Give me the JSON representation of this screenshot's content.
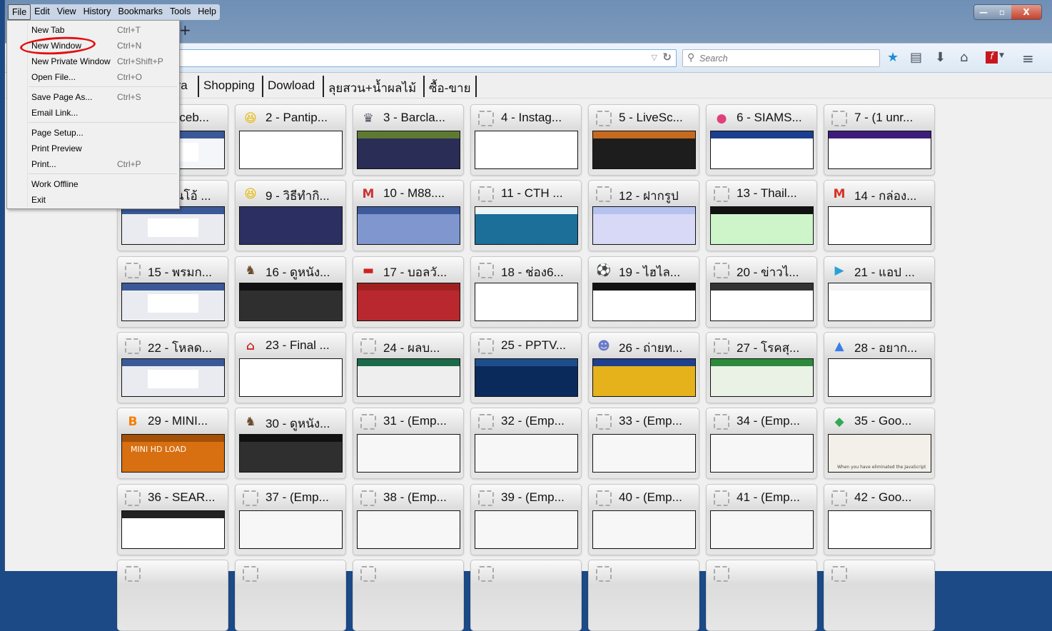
{
  "window": {
    "controls": {
      "minimize": "—",
      "maximize": "▫",
      "close": "X"
    }
  },
  "menubar": [
    "File",
    "Edit",
    "View",
    "History",
    "Bookmarks",
    "Tools",
    "Help"
  ],
  "file_menu": [
    {
      "label": "New Tab",
      "shortcut": "Ctrl+T"
    },
    {
      "label": "New Window",
      "shortcut": "Ctrl+N"
    },
    {
      "label": "New Private Window",
      "shortcut": "Ctrl+Shift+P"
    },
    {
      "label": "Open File...",
      "shortcut": "Ctrl+O"
    },
    {
      "label": "Save Page As...",
      "shortcut": "Ctrl+S"
    },
    {
      "label": "Email Link...",
      "shortcut": ""
    },
    {
      "label": "Page Setup...",
      "shortcut": ""
    },
    {
      "label": "Print Preview",
      "shortcut": ""
    },
    {
      "label": "Print...",
      "shortcut": "Ctrl+P"
    },
    {
      "label": "Work Offline",
      "shortcut": ""
    },
    {
      "label": "Exit",
      "shortcut": ""
    }
  ],
  "new_tab_label": "+",
  "search": {
    "placeholder": "Search"
  },
  "bookmarks": [
    "Extra",
    "Shopping",
    "Dowload",
    "ลุยสวน+น้ำผลไม้",
    "ซื้อ-ขาย"
  ],
  "tiles": [
    {
      "title": "1 - Faceb...",
      "icon": "dashed",
      "thumb": [
        "#f4f6fa",
        "#3b5998"
      ]
    },
    {
      "title": "2 - Pantip...",
      "icon": "smiley",
      "thumb": [
        "#ffffff",
        "#ffffff"
      ]
    },
    {
      "title": "3 - Barcla...",
      "icon": "premier",
      "thumb": [
        "#2a2d55",
        "#5e7a32"
      ]
    },
    {
      "title": "4 - Instag...",
      "icon": "dashed",
      "thumb": [
        "#ffffff",
        "#ffffff"
      ]
    },
    {
      "title": "5 - LiveSc...",
      "icon": "dashed",
      "thumb": [
        "#1d1d1d",
        "#c66a20"
      ]
    },
    {
      "title": "6 - SIAMS...",
      "icon": "siam",
      "thumb": [
        "#ffffff",
        "#1a3f8f"
      ]
    },
    {
      "title": "7 - (1 unr...",
      "icon": "dashed",
      "thumb": [
        "#ffffff",
        "#3d1c7a"
      ]
    },
    {
      "title": "8 - ...นโอ้ ...",
      "icon": "dashed",
      "thumb": [
        "#e9ebf0",
        "#3b5998"
      ]
    },
    {
      "title": "9 - วิธีทำกิ...",
      "icon": "smiley",
      "thumb": [
        "#2c2f62",
        "#2c2f62"
      ]
    },
    {
      "title": "10 - M88....",
      "icon": "m88",
      "thumb": [
        "#7f96cf",
        "#3d5a9a"
      ]
    },
    {
      "title": "11 - CTH ...",
      "icon": "dashed",
      "thumb": [
        "#1b6f99",
        "#eef5f7"
      ]
    },
    {
      "title": "12 - ฝากรูป",
      "icon": "dashed",
      "thumb": [
        "#d7d9f7",
        "#b5c2f0"
      ]
    },
    {
      "title": "13 - Thail...",
      "icon": "dashed",
      "thumb": [
        "#cdf5c9",
        "#111111"
      ]
    },
    {
      "title": "14 - กล่อง...",
      "icon": "gmail",
      "thumb": [
        "#ffffff",
        "#ffffff"
      ]
    },
    {
      "title": "15 - พรมก...",
      "icon": "dashed",
      "thumb": [
        "#e9ebf0",
        "#3b5998"
      ]
    },
    {
      "title": "16 - ดูหนัง...",
      "icon": "monkey",
      "thumb": [
        "#2f2f2f",
        "#111111"
      ]
    },
    {
      "title": "17 - บอลวั...",
      "icon": "thaiflag",
      "thumb": [
        "#b8282e",
        "#a02020"
      ]
    },
    {
      "title": "18 - ช่อง6...",
      "icon": "dashed",
      "thumb": [
        "#ffffff",
        "#ffffff"
      ]
    },
    {
      "title": "19 - ไฮไล...",
      "icon": "ball",
      "thumb": [
        "#ffffff",
        "#111111"
      ]
    },
    {
      "title": "20 - ข่าวไ...",
      "icon": "dashed",
      "thumb": [
        "#ffffff",
        "#333333"
      ]
    },
    {
      "title": "21 - แอป ...",
      "icon": "play",
      "thumb": [
        "#ffffff",
        "#f5f5f5"
      ]
    },
    {
      "title": "22 - โหลด...",
      "icon": "dashed",
      "thumb": [
        "#e9ebf0",
        "#3b5998"
      ]
    },
    {
      "title": "23 - Final ...",
      "icon": "chair",
      "thumb": [
        "#ffffff",
        "#ffffff"
      ]
    },
    {
      "title": "24 - ผลบ...",
      "icon": "dashed",
      "thumb": [
        "#eeeeee",
        "#1b6a4a"
      ]
    },
    {
      "title": "25 - PPTV...",
      "icon": "dashed",
      "thumb": [
        "#0a2a5c",
        "#1c4f8a"
      ]
    },
    {
      "title": "26 - ถ่ายท...",
      "icon": "owl",
      "thumb": [
        "#e5b21b",
        "#1f3f8f"
      ]
    },
    {
      "title": "27 - โรคสุ...",
      "icon": "dashed",
      "thumb": [
        "#eaf2e6",
        "#2c8a3c"
      ]
    },
    {
      "title": "28 - อยาก...",
      "icon": "gbubble",
      "thumb": [
        "#ffffff",
        "#ffffff"
      ]
    },
    {
      "title": "29 - MINI...",
      "icon": "blogger",
      "thumb": [
        "#d86f10",
        "#a35008"
      ]
    },
    {
      "title": "30 - ดูหนัง...",
      "icon": "monkey",
      "thumb": [
        "#2f2f2f",
        "#111111"
      ]
    },
    {
      "title": "31 - (Emp...",
      "icon": "dashed",
      "thumb": [
        "#f7f7f7",
        "#f7f7f7"
      ]
    },
    {
      "title": "32 - (Emp...",
      "icon": "dashed",
      "thumb": [
        "#f7f7f7",
        "#f7f7f7"
      ]
    },
    {
      "title": "33 - (Emp...",
      "icon": "dashed",
      "thumb": [
        "#f7f7f7",
        "#f7f7f7"
      ]
    },
    {
      "title": "34 - (Emp...",
      "icon": "dashed",
      "thumb": [
        "#f7f7f7",
        "#f7f7f7"
      ]
    },
    {
      "title": "35 - Goo...",
      "icon": "maps",
      "thumb": [
        "#f2f0e8",
        "#f2f0e8"
      ]
    },
    {
      "title": "36 - SEAR...",
      "icon": "dashed",
      "thumb": [
        "#ffffff",
        "#222222"
      ]
    },
    {
      "title": "37 - (Emp...",
      "icon": "dashed",
      "thumb": [
        "#f7f7f7",
        "#f7f7f7"
      ]
    },
    {
      "title": "38 - (Emp...",
      "icon": "dashed",
      "thumb": [
        "#f7f7f7",
        "#f7f7f7"
      ]
    },
    {
      "title": "39 - (Emp...",
      "icon": "dashed",
      "thumb": [
        "#f7f7f7",
        "#f7f7f7"
      ]
    },
    {
      "title": "40 - (Emp...",
      "icon": "dashed",
      "thumb": [
        "#f7f7f7",
        "#f7f7f7"
      ]
    },
    {
      "title": "41 - (Emp...",
      "icon": "dashed",
      "thumb": [
        "#f7f7f7",
        "#f7f7f7"
      ]
    },
    {
      "title": "42 - Goo...",
      "icon": "dashed",
      "thumb": [
        "#ffffff",
        "#ffffff"
      ]
    }
  ],
  "tile_extra": {
    "29": "MINI HD LOAD",
    "35": "When you have eliminated the JavaScript"
  }
}
